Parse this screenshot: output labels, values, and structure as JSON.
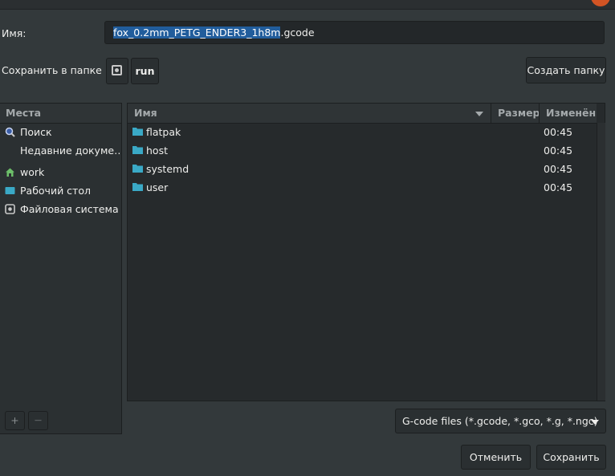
{
  "dialog": {
    "name_label": "Имя:",
    "filename_selected": "fox_0.2mm_PETG_ENDER3_1h8m",
    "filename_ext": ".gcode",
    "save_in_label": "Сохранить в папке",
    "path_segment": "run",
    "create_folder_label": "Создать папку",
    "cancel_label": "Отменить",
    "save_label": "Сохранить"
  },
  "places": {
    "header": "Места",
    "items": [
      {
        "label": "Поиск",
        "icon": "search-icon"
      },
      {
        "label": "Недавние докуме…",
        "icon": ""
      },
      {
        "label": "work",
        "icon": "home-icon"
      },
      {
        "label": "Рабочий стол",
        "icon": "desktop-folder-icon"
      },
      {
        "label": "Файловая система",
        "icon": "drive-icon"
      }
    ],
    "add_label": "+",
    "remove_label": "—"
  },
  "files": {
    "columns": {
      "name": "Имя",
      "size": "Размер",
      "modified": "Изменён"
    },
    "rows": [
      {
        "name": "flatpak",
        "size": "",
        "modified": "00:45"
      },
      {
        "name": "host",
        "size": "",
        "modified": "00:45"
      },
      {
        "name": "systemd",
        "size": "",
        "modified": "00:45"
      },
      {
        "name": "user",
        "size": "",
        "modified": "00:45"
      }
    ]
  },
  "filter": {
    "selected": "G-code files (*.gcode, *.gco, *.g, *.ngc)"
  },
  "colors": {
    "background": "#33393b",
    "selection": "#215d9c",
    "folder": "#3aa9c6",
    "close": "#d25424"
  }
}
